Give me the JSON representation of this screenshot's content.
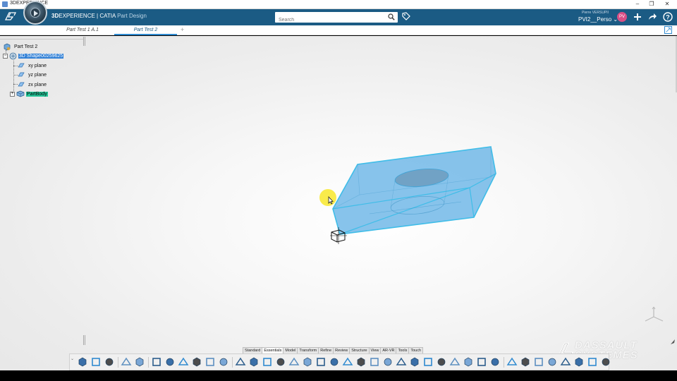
{
  "window": {
    "title": "3DEXPERIENCE",
    "minimize": "–",
    "maximize": "❐",
    "close": "✕"
  },
  "header": {
    "brand_bold": "3D",
    "brand_rest": "EXPERIENCE | CATIA",
    "app_name": "Part Design",
    "search_placeholder": "Search",
    "user_name": "Pierre VERSUPII",
    "tenant": "PVI2__Perso",
    "avatar_initials": "PV",
    "accent": "#1b5b84"
  },
  "tabs": [
    {
      "label": "Part Test 1 A.1",
      "active": false
    },
    {
      "label": "Part Test 2",
      "active": true
    }
  ],
  "tab_add": "+",
  "tree": {
    "root": "Part Test 2",
    "shape": "3D Shape00259625",
    "planes": [
      "xy plane",
      "yz plane",
      "zx plane"
    ],
    "body": "PartBody"
  },
  "section_tabs": [
    "Standard",
    "Essentials",
    "Model",
    "Transform",
    "Refine",
    "Review",
    "Structure",
    "View",
    "AR-VR",
    "Tools",
    "Touch"
  ],
  "active_section": "Essentials",
  "watermark": {
    "line1": "DASSAULT",
    "line2": "SYSTEMES"
  },
  "toolbar_icons": [
    "cut-icon",
    "copy-icon",
    "paste-icon",
    "undo-icon",
    "update-icon",
    "sketch-icon",
    "sketch-position-icon",
    "point-icon",
    "line-icon",
    "plane-icon",
    "axis-system-icon",
    "pad-icon",
    "pocket-icon",
    "shaft-icon",
    "groove-icon",
    "rib-icon",
    "hole-icon",
    "thread-icon",
    "fillet-icon",
    "chamfer-icon",
    "draft-icon",
    "shell-icon",
    "thickness-icon",
    "pattern-icon",
    "circular-pattern-icon",
    "mirror-icon",
    "multi-section-icon",
    "split-icon",
    "add-icon",
    "remove-icon",
    "intersect-icon",
    "measure-icon",
    "section-icon",
    "render-icon",
    "material-icon",
    "publish-icon",
    "snap-icon",
    "compass-icon",
    "lights-icon"
  ]
}
